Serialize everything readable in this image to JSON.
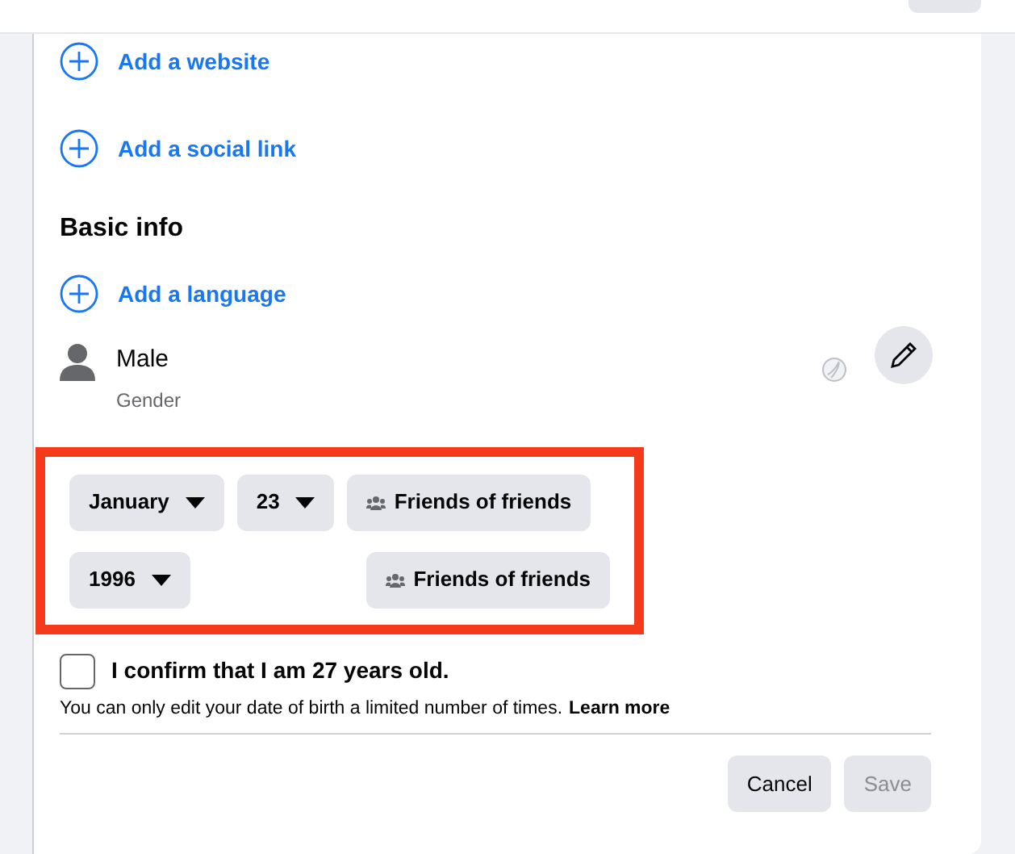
{
  "links_top": [
    {
      "label": "Add a website"
    },
    {
      "label": "Add a social link"
    }
  ],
  "basic_info": {
    "heading": "Basic info",
    "add_language": "Add a language",
    "gender": {
      "value": "Male",
      "label": "Gender"
    }
  },
  "birthday_rows": [
    {
      "fields": [
        {
          "kind": "select",
          "value": "January"
        },
        {
          "kind": "select",
          "value": "23"
        },
        {
          "kind": "audience",
          "value": "Friends of friends"
        }
      ]
    },
    {
      "fields": [
        {
          "kind": "select",
          "value": "1996"
        },
        {
          "kind": "spacer"
        },
        {
          "kind": "audience",
          "value": "Friends of friends"
        }
      ]
    }
  ],
  "confirm": {
    "label": "I confirm that I am 27 years old.",
    "checked": false
  },
  "note": {
    "text": "You can only edit your date of birth a limited number of times.",
    "link": "Learn more"
  },
  "buttons": [
    {
      "label": "Cancel",
      "disabled": false
    },
    {
      "label": "Save",
      "disabled": true
    }
  ]
}
